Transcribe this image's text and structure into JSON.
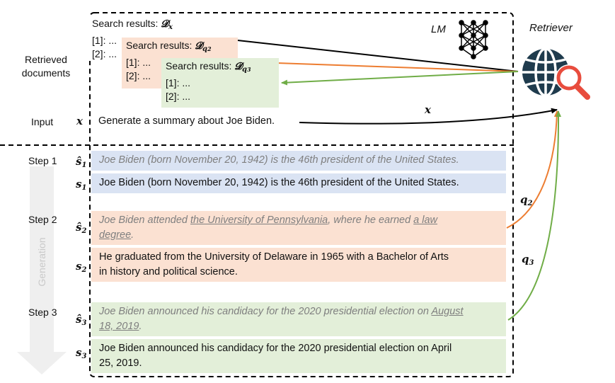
{
  "labels": {
    "retrieved_documents_1": "Retrieved",
    "retrieved_documents_2": "documents",
    "input": "Input",
    "step1": "Step 1",
    "step2": "Step 2",
    "step3": "Step 3",
    "generation": "Generation",
    "lm": "LM",
    "retriever": "Retriever"
  },
  "symbols": {
    "x": "x",
    "s_hat": "ŝ",
    "s": "s",
    "sub1": "1",
    "sub2": "2",
    "sub3": "3",
    "q": "q",
    "D": "𝓓",
    "Dx_sub": "x",
    "Dq2_sub": "q",
    "Dq3_sub": "q"
  },
  "search_panels": {
    "title": "Search results:",
    "item1": "[1]: ...",
    "item2": "[2]: ..."
  },
  "input_text": "Generate a summary about Joe Biden.",
  "steps": {
    "s1_hat": "Joe Biden (born November 20, 1942) is the 46th president of the United States.",
    "s1": "Joe Biden (born November 20, 1942) is the 46th president of the United States.",
    "s2_hat_a": "Joe Biden attended ",
    "s2_hat_u1": "the University of Pennsylvania",
    "s2_hat_b": ", where he earned ",
    "s2_hat_u2": "a law",
    "s2_hat_u3": "degree",
    "s2_hat_c": ".",
    "s2_line1": "He graduated from the University of Delaware in 1965 with a Bachelor of Arts",
    "s2_line2": "in history and political science.",
    "s3_hat_a": "Joe Biden announced his candidacy for the 2020 presidential election on ",
    "s3_hat_u1": "August",
    "s3_hat_u2": "18, 2019",
    "s3_hat_b": ".",
    "s3_line1": "Joe Biden announced his candidacy for the 2020 presidential election on April",
    "s3_line2": "25, 2019."
  },
  "colors": {
    "orange": "#ed7d31",
    "green": "#70ad47",
    "blue_row": "#dae3f3",
    "orange_row": "#fbe1d2",
    "green_row": "#e3efd9",
    "retriever_dark": "#1f3b4d",
    "retriever_red": "#e84c3d"
  }
}
